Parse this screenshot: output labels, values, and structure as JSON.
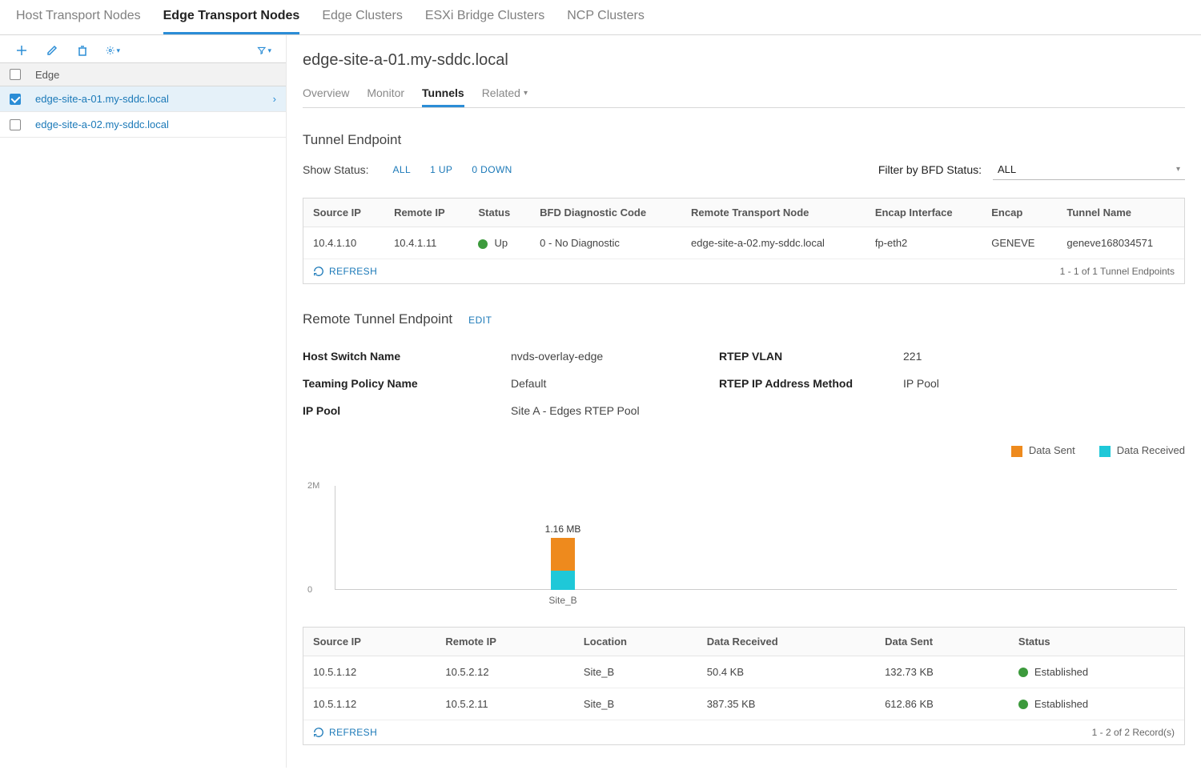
{
  "top_tabs": [
    "Host Transport Nodes",
    "Edge Transport Nodes",
    "Edge Clusters",
    "ESXi Bridge Clusters",
    "NCP Clusters"
  ],
  "top_tab_active_index": 1,
  "left": {
    "header": "Edge",
    "rows": [
      {
        "name": "edge-site-a-01.my-sddc.local",
        "selected": true
      },
      {
        "name": "edge-site-a-02.my-sddc.local",
        "selected": false
      }
    ]
  },
  "detail": {
    "title": "edge-site-a-01.my-sddc.local",
    "sub_tabs": [
      "Overview",
      "Monitor",
      "Tunnels",
      "Related"
    ],
    "sub_tab_active_index": 2,
    "tunnel_endpoint": {
      "title": "Tunnel Endpoint",
      "show_status_label": "Show Status:",
      "status_links": [
        "ALL",
        "1 UP",
        "0 DOWN"
      ],
      "bfd_filter_label": "Filter by BFD Status:",
      "bfd_filter_value": "ALL",
      "columns": [
        "Source IP",
        "Remote IP",
        "Status",
        "BFD Diagnostic Code",
        "Remote Transport Node",
        "Encap Interface",
        "Encap",
        "Tunnel Name"
      ],
      "rows": [
        {
          "source_ip": "10.4.1.10",
          "remote_ip": "10.4.1.11",
          "status": "Up",
          "bfd": "0 - No Diagnostic",
          "remote_node": "edge-site-a-02.my-sddc.local",
          "encap_if": "fp-eth2",
          "encap": "GENEVE",
          "tunnel_name": "geneve168034571"
        }
      ],
      "refresh": "REFRESH",
      "footer": "1 - 1 of 1 Tunnel Endpoints"
    },
    "rtep": {
      "title": "Remote Tunnel Endpoint",
      "edit": "EDIT",
      "kv": {
        "host_switch_label": "Host Switch Name",
        "host_switch_val": "nvds-overlay-edge",
        "rtep_vlan_label": "RTEP VLAN",
        "rtep_vlan_val": "221",
        "teaming_label": "Teaming Policy Name",
        "teaming_val": "Default",
        "ip_method_label": "RTEP IP Address Method",
        "ip_method_val": "IP Pool",
        "ip_pool_label": "IP Pool",
        "ip_pool_val": "Site A - Edges RTEP Pool"
      },
      "legend": {
        "sent": "Data Sent",
        "recv": "Data Received"
      },
      "table": {
        "columns": [
          "Source IP",
          "Remote IP",
          "Location",
          "Data Received",
          "Data Sent",
          "Status"
        ],
        "rows": [
          {
            "source_ip": "10.5.1.12",
            "remote_ip": "10.5.2.12",
            "location": "Site_B",
            "recv": "50.4 KB",
            "sent": "132.73 KB",
            "status": "Established"
          },
          {
            "source_ip": "10.5.1.12",
            "remote_ip": "10.5.2.11",
            "location": "Site_B",
            "recv": "387.35 KB",
            "sent": "612.86 KB",
            "status": "Established"
          }
        ],
        "refresh": "REFRESH",
        "footer": "1 - 2 of 2 Record(s)"
      }
    }
  },
  "chart_data": {
    "type": "bar",
    "title": "",
    "ylabel": "",
    "ylim": [
      0,
      2000000
    ],
    "yticks": [
      "2M",
      "0"
    ],
    "categories": [
      "Site_B"
    ],
    "series": [
      {
        "name": "Data Sent",
        "color": "#ee8a1d",
        "values": [
          745590
        ]
      },
      {
        "name": "Data Received",
        "color": "#1fc8d8",
        "values": [
          437750
        ]
      }
    ],
    "bar_top_labels": [
      "1.16 MB"
    ]
  }
}
